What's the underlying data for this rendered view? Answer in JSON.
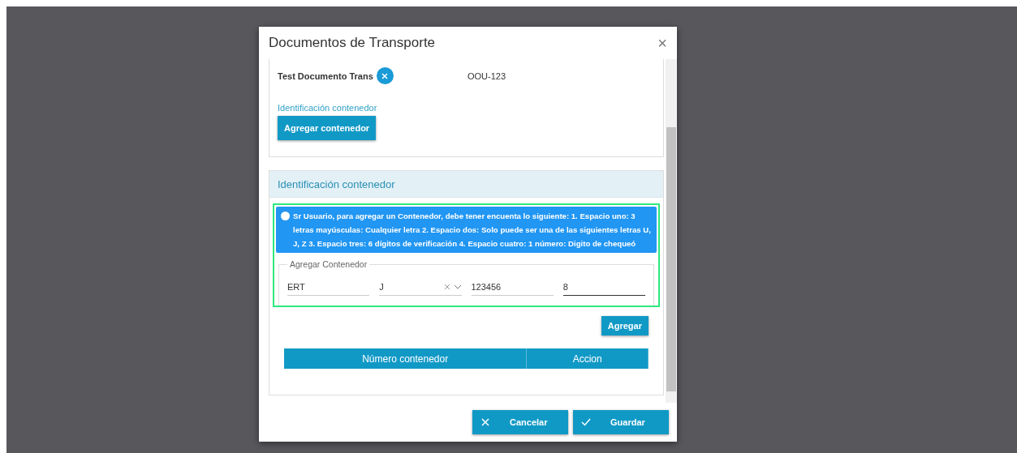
{
  "dialog": {
    "title": "Documentos de Transporte",
    "close": "×"
  },
  "top_card": {
    "file_name": "Test Documento Trans",
    "transport_id": "OOU-123",
    "container_label": "Identificación contenedor",
    "add_button": "Agregar contenedor"
  },
  "container_panel": {
    "title": "Identificación contenedor",
    "alert": "Sr Usuario, para agregar un Contenedor, debe tener encuenta lo siguiente: 1. Espacio uno: 3 letras mayúsculas: Cualquier letra 2. Espacio dos: Solo puede ser una de las siguientes letras U, J, Z 3. Espacio tres: 6 dígitos de verificación 4. Espacio cuatro: 1 número: Digito de chequeó",
    "fieldset_legend": "Agregar Contenedor",
    "fields": [
      {
        "kind": "text",
        "value": "ERT",
        "focused": false
      },
      {
        "kind": "select",
        "value": "J",
        "focused": false
      },
      {
        "kind": "text",
        "value": "123456",
        "focused": false
      },
      {
        "kind": "text",
        "value": "8",
        "focused": true
      }
    ],
    "add_button": "Agregar",
    "table": {
      "columns": [
        "Número contenedor",
        "Accion"
      ]
    }
  },
  "footer": {
    "buttons": [
      {
        "kind": "cancel",
        "label": "Cancelar"
      },
      {
        "kind": "save",
        "label": "Guardar"
      }
    ]
  }
}
